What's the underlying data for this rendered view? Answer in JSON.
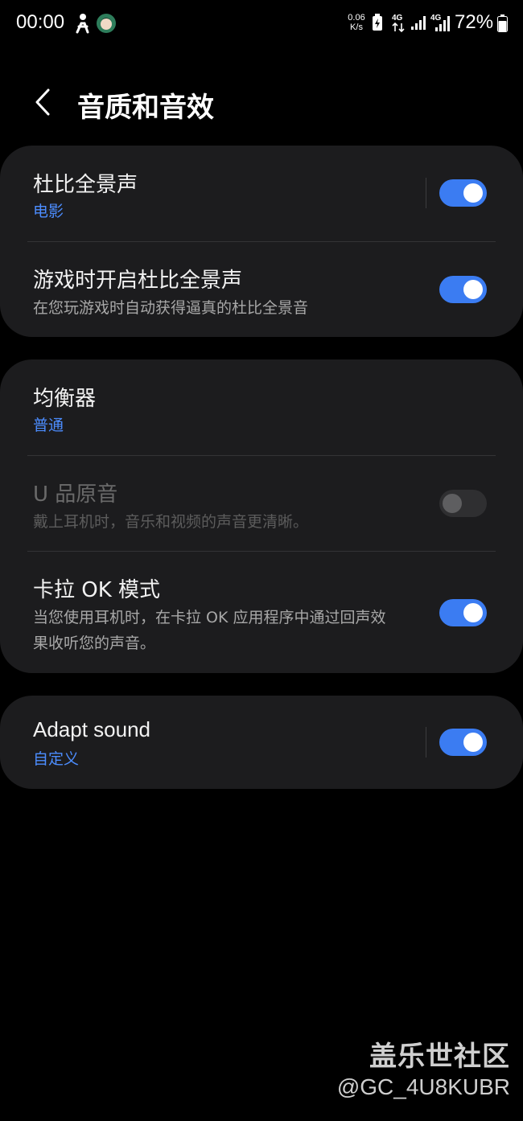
{
  "status_bar": {
    "time": "00:00",
    "net_speed_value": "0.06",
    "net_speed_unit": "K/s",
    "network_1": "4G",
    "network_2": "4G",
    "battery_percent": "72%",
    "icons": [
      "walker-icon",
      "avatar-icon",
      "battery-saver-icon",
      "signal-icon-1",
      "signal-icon-2",
      "battery-icon"
    ]
  },
  "header": {
    "title": "音质和音效"
  },
  "card_1": {
    "dolby": {
      "title": "杜比全景声",
      "subtitle": "电影",
      "enabled": true
    },
    "game_dolby": {
      "title": "游戏时开启杜比全景声",
      "subtitle": "在您玩游戏时自动获得逼真的杜比全景音",
      "enabled": true
    }
  },
  "card_2": {
    "equalizer": {
      "title": "均衡器",
      "subtitle": "普通"
    },
    "uhq": {
      "title": "U 品原音",
      "subtitle": "戴上耳机时，音乐和视频的声音更清晰。",
      "enabled": false,
      "disabled": true
    },
    "karaoke": {
      "title": "卡拉 OK 模式",
      "subtitle_line1": "当您使用耳机时，在卡拉 OK 应用程序中通过回声效",
      "subtitle_line2": "果收听您的声音。",
      "enabled": true
    }
  },
  "card_3": {
    "adapt_sound": {
      "title": "Adapt sound",
      "subtitle": "自定义",
      "enabled": true
    }
  },
  "watermark": {
    "name": "盖乐世社区",
    "user": "@GC_4U8KUBR"
  },
  "colors": {
    "accent": "#4c8dff",
    "toggle_on": "#3b7cf2",
    "card_bg": "#1c1c1e",
    "background": "#000000"
  }
}
